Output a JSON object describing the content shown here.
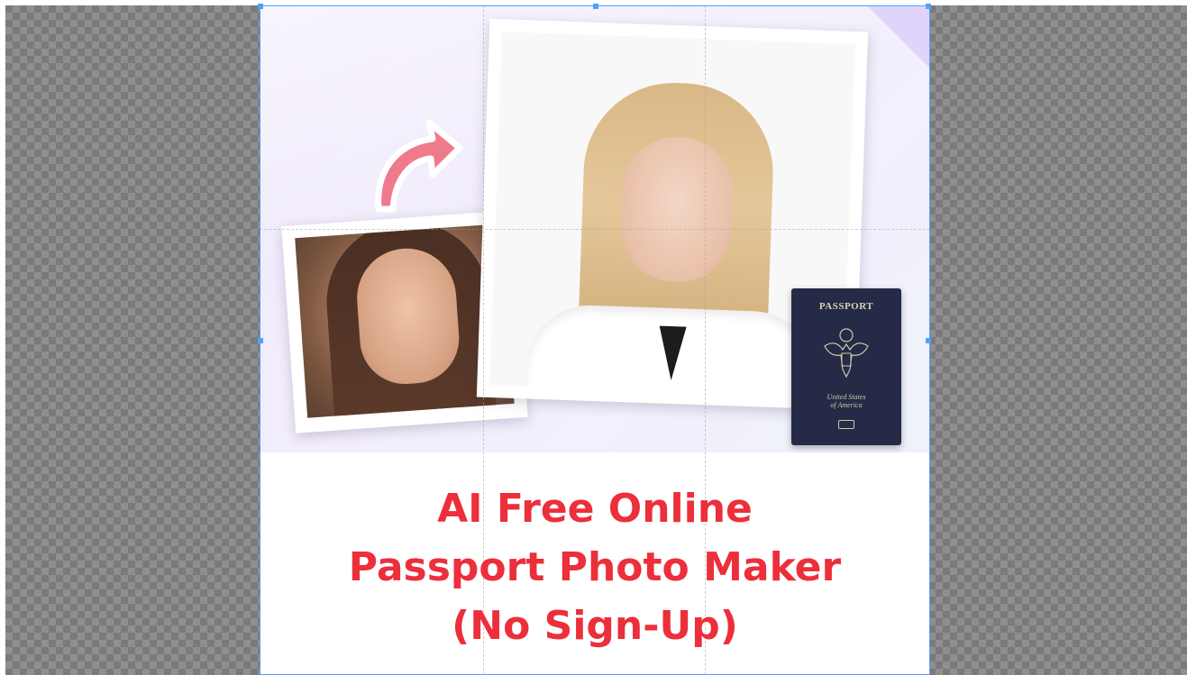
{
  "canvas": {
    "checker_dark": "#7a7a7a",
    "checker_light": "#8f8f8f",
    "selection_color": "#4ea2ff"
  },
  "artwork": {
    "headline_lines": [
      "AI Free Online",
      "Passport Photo Maker",
      "(No Sign-Up)"
    ],
    "headline_color": "#ec2f3b",
    "passport": {
      "title": "PASSPORT",
      "subtitle": "United States\nof America"
    },
    "icons": {
      "arrow": "curved-arrow-icon",
      "emblem": "eagle-seal-icon"
    }
  }
}
